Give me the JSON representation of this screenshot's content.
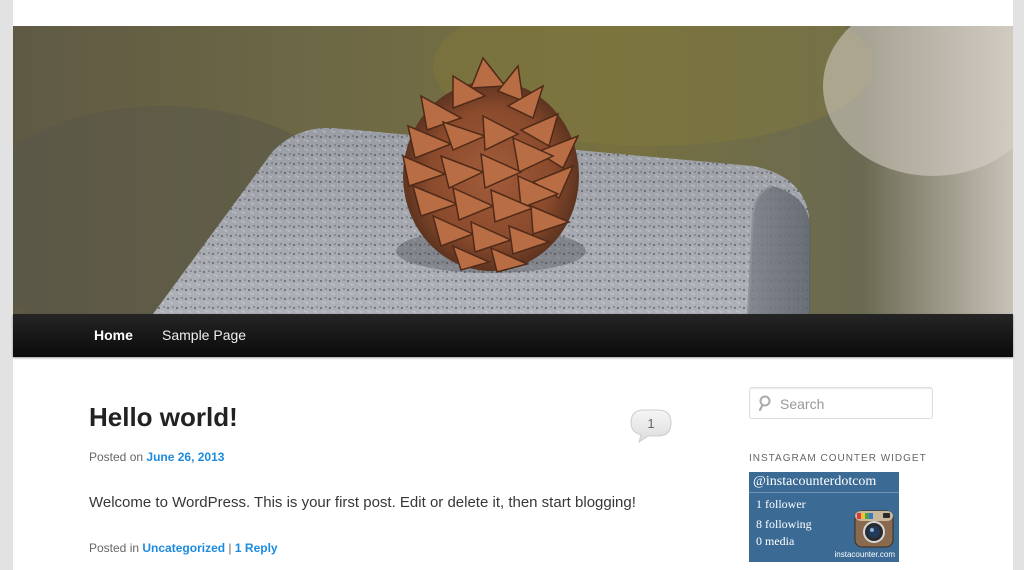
{
  "nav": {
    "items": [
      {
        "label": "Home"
      },
      {
        "label": "Sample Page"
      }
    ]
  },
  "post": {
    "title": "Hello world!",
    "comment_count": "1",
    "posted_on_label": "Posted on",
    "date": "June 26, 2013",
    "content": "Welcome to WordPress. This is your first post. Edit or delete it, then start blogging!",
    "posted_in_label": "Posted in",
    "category": "Uncategorized",
    "separator": "|",
    "reply_link": "1 Reply"
  },
  "sidebar": {
    "search": {
      "placeholder": "Search",
      "icon": "search-icon"
    },
    "widget_title": "INSTAGRAM COUNTER WIDGET",
    "instagram": {
      "handle": "@instacounterdotcom",
      "followers": "1 follower",
      "following": "8 following",
      "media": "0 media",
      "site": "instacounter.com",
      "icon": "instagram-camera-icon"
    }
  },
  "colors": {
    "link": "#1b8be0",
    "nav_bg": "#1a1a1a",
    "widget_bg": "#3b6b95",
    "page_bg": "#e2e2e2"
  }
}
